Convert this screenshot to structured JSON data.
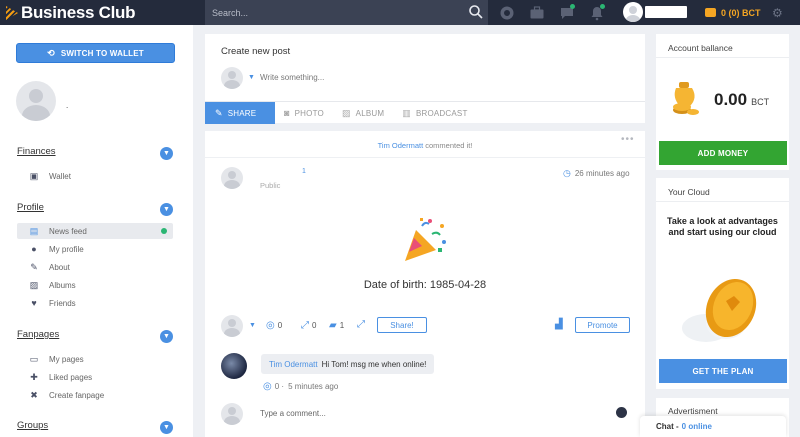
{
  "header": {
    "brand": "Business Club",
    "search_placeholder": "Search...",
    "wallet_balance": "0 (0) BCT",
    "icons": [
      "search-icon",
      "support-icon",
      "briefcase-icon",
      "chat-icon",
      "bell-icon",
      "wallet-icon",
      "gear-icon"
    ]
  },
  "sidebar": {
    "switch_wallet": "SWITCH TO WALLET",
    "user_name": ".",
    "sections": {
      "finances": {
        "title": "Finances",
        "items": [
          {
            "label": "Wallet",
            "icon": "wallet-icon"
          }
        ]
      },
      "profile": {
        "title": "Profile",
        "items": [
          {
            "label": "News feed",
            "icon": "newspaper-icon"
          },
          {
            "label": "My profile",
            "icon": "user-icon"
          },
          {
            "label": "About",
            "icon": "pencil-icon"
          },
          {
            "label": "Albums",
            "icon": "image-icon"
          },
          {
            "label": "Friends",
            "icon": "heart-icon"
          }
        ]
      },
      "fanpages": {
        "title": "Fanpages",
        "items": [
          {
            "label": "My pages",
            "icon": "page-icon"
          },
          {
            "label": "Liked pages",
            "icon": "liked-icon"
          },
          {
            "label": "Create fanpage",
            "icon": "tools-icon"
          }
        ]
      },
      "groups": {
        "title": "Groups"
      }
    }
  },
  "composer": {
    "title": "Create new post",
    "placeholder": "Write something...",
    "tabs": [
      "SHARE",
      "PHOTO",
      "ALBUM",
      "BROADCAST"
    ]
  },
  "post": {
    "commenter": "Tim Odermatt",
    "commented_text": "commented it!",
    "visibility": "Public",
    "badge_count": "1",
    "time": "26 minutes ago",
    "content": "Date of birth: 1985-04-28",
    "likes": "0",
    "shares": "0",
    "comments": "1",
    "share_label": "Share!",
    "promote_label": "Promote",
    "comment": {
      "author": "Tim Odermatt",
      "text": "Hi Tom! msg me when online!",
      "likes": "0 ·",
      "time": "5 minutes ago"
    },
    "comment_placeholder": "Type a comment..."
  },
  "account": {
    "title": "Account ballance",
    "amount": "0.00",
    "currency": "BCT",
    "add_money": "ADD MONEY"
  },
  "cloud": {
    "title": "Your Cloud",
    "text": "Take a look at advantages and start using our cloud",
    "cta": "GET THE PLAN"
  },
  "advert": {
    "title": "Advertisment"
  },
  "chat": {
    "label": "Chat -",
    "online": "0 online"
  },
  "colors": {
    "topbar": "#242b3c",
    "accent": "#4a90e2",
    "green": "#33a532",
    "gold": "#f5a623"
  }
}
